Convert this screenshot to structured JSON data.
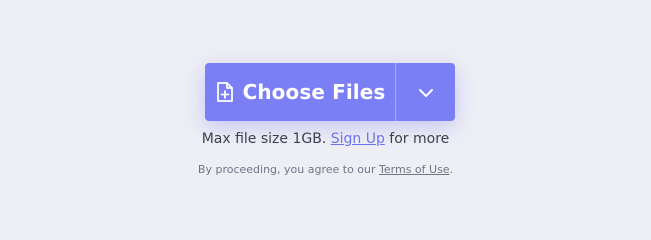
{
  "upload": {
    "choose_label": "Choose Files",
    "dropdown_icon": "chevron-down-icon",
    "file_icon": "file-plus-icon"
  },
  "info": {
    "prefix": "Max file size 1GB. ",
    "signup_link": "Sign Up",
    "suffix": " for more"
  },
  "terms": {
    "prefix": "By proceeding, you agree to our ",
    "link": "Terms of Use",
    "suffix": "."
  },
  "colors": {
    "button_bg": "#7b7ff5",
    "page_bg": "#eeeef5",
    "link": "#6d72ef"
  }
}
